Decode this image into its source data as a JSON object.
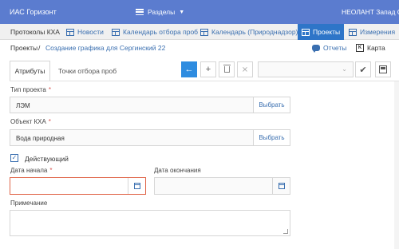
{
  "topbar": {
    "app_title": "ИАС Горизонт",
    "sections_label": "Разделы",
    "org_name": "НЕОЛАНТ Запад Су"
  },
  "nav": {
    "items": [
      {
        "label": "Протоколы КХА",
        "icon": "table-icon"
      },
      {
        "label": "Новости",
        "icon": "table-icon"
      },
      {
        "label": "Календарь отбора проб",
        "icon": "table-icon"
      },
      {
        "label": "Календарь (Природнадзор)",
        "icon": "table-icon"
      },
      {
        "label": "Проекты",
        "icon": "table-icon",
        "active": true
      },
      {
        "label": "Измерения",
        "icon": "table-icon"
      }
    ]
  },
  "breadcrumb": {
    "root": "Проекты",
    "separator": "/",
    "current": "Создание графика для Сергинский 22"
  },
  "actions": {
    "reports_label": "Отчеты",
    "map_label": "Карта"
  },
  "tabs": {
    "attributes": "Атрибуты",
    "sampling_points": "Точки отбора проб"
  },
  "form": {
    "project_type_label": "Тип проекта",
    "project_type_value": "ЛЭМ",
    "object_label": "Объект КХА",
    "object_value": "Вода природная",
    "pick_label": "Выбрать",
    "active_label": "Действующий",
    "active_checked": true,
    "start_date_label": "Дата начала",
    "start_date_value": "",
    "end_date_label": "Дата окончания",
    "end_date_value": "",
    "note_label": "Примечание",
    "note_value": "",
    "required_mark": "*"
  },
  "colors": {
    "topbar": "#5b7ccf",
    "active_nav": "#2e75c8",
    "primary_button": "#2e8ce0",
    "link": "#3a6fb0",
    "error_border": "#e0664a",
    "required": "#d9534f"
  }
}
